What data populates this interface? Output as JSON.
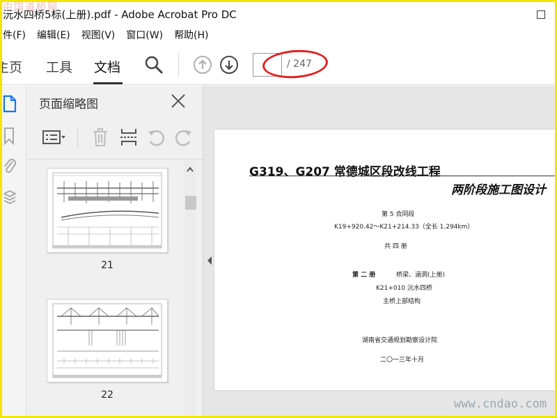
{
  "window": {
    "title": "沅水四桥5标(上册).pdf - Adobe Acrobat Pro DC"
  },
  "watermark_top": "中国道桥网",
  "menu": [
    {
      "label": "件(F)"
    },
    {
      "label": "编辑(E)"
    },
    {
      "label": "视图(V)"
    },
    {
      "label": "窗口(W)"
    },
    {
      "label": "帮助(H)"
    }
  ],
  "tabs": [
    {
      "label": "主页"
    },
    {
      "label": "工具"
    },
    {
      "label": "文档"
    }
  ],
  "toolbar": {
    "page_input_value": "",
    "page_total": "/ 247"
  },
  "panel": {
    "title": "页面缩略图",
    "thumbnails": [
      {
        "label": "21"
      },
      {
        "label": "22"
      }
    ]
  },
  "document": {
    "title": "G319、G207 常德城区段改线工程",
    "subtitle": "两阶段施工图设计",
    "contract": "第 5 合同段",
    "range": "K19+920.42～K21+214.33（全长 1.294km）",
    "volumes": "共 四 册",
    "volume_part": "第 二 册",
    "volume_name": "桥梁、涵洞(上册)",
    "bridge": "K21+010 沅水四桥",
    "structure": "主桥上部结构",
    "institute": "湖南省交通规划勘察设计院",
    "date": "二〇一三年十月"
  },
  "watermark_bottom": "www.cndao.com",
  "colors": {
    "frame": "#f2e600",
    "ellipse": "#e02020"
  }
}
